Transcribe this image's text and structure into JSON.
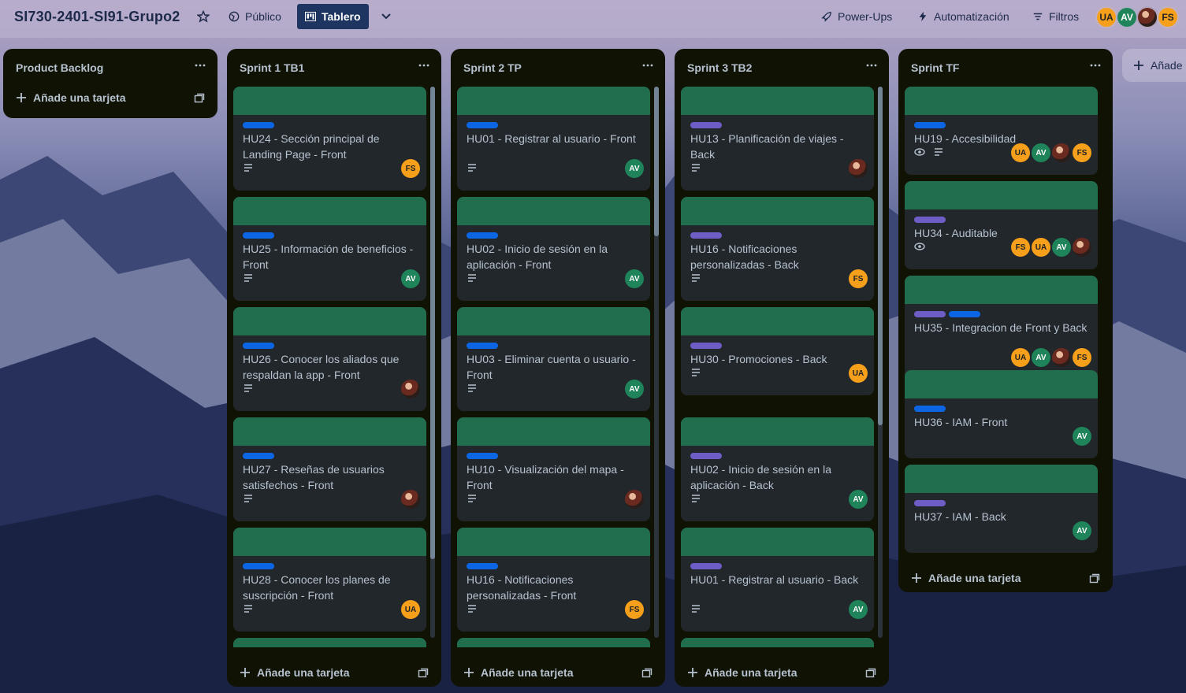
{
  "header": {
    "board_title": "SI730-2401-SI91-Grupo2",
    "visibility": "Público",
    "view": "Tablero",
    "powerups": "Power-Ups",
    "automation": "Automatización",
    "filters": "Filtros",
    "members": [
      {
        "initials": "UA",
        "color": "#f59f1b"
      },
      {
        "initials": "AV",
        "color": "#1f845a"
      },
      {
        "initials": "",
        "photo": true
      },
      {
        "initials": "FS",
        "color": "#f59f1b"
      }
    ]
  },
  "add_card_label": "Añade una tarjeta",
  "add_list_label": "Añade",
  "lists": [
    {
      "title": "Product Backlog",
      "cards": []
    },
    {
      "title": "Sprint 1 TB1",
      "cards": [
        {
          "labels": [
            "blue"
          ],
          "title": "HU24 - Sección principal de Landing Page - Front",
          "members": [
            "FS"
          ]
        },
        {
          "labels": [
            "blue"
          ],
          "title": "HU25 - Información de beneficios - Front",
          "members": [
            "AV"
          ]
        },
        {
          "labels": [
            "blue"
          ],
          "title": "HU26 - Conocer los aliados que respaldan la app - Front",
          "members": [
            "photo"
          ]
        },
        {
          "labels": [
            "blue"
          ],
          "title": "HU27 - Reseñas de usuarios satisfechos - Front",
          "members": [
            "photo"
          ]
        },
        {
          "labels": [
            "blue"
          ],
          "title": "HU28 - Conocer los planes de suscripción - Front",
          "members": [
            "UA"
          ]
        }
      ]
    },
    {
      "title": "Sprint 2 TP",
      "cards": [
        {
          "labels": [
            "blue"
          ],
          "title": "HU01 - Registrar al usuario - Front",
          "members": [
            "AV"
          ]
        },
        {
          "labels": [
            "blue"
          ],
          "title": "HU02 - Inicio de sesión en la aplicación - Front",
          "members": [
            "AV"
          ]
        },
        {
          "labels": [
            "blue"
          ],
          "title": "HU03 - Eliminar cuenta o usuario - Front",
          "members": [
            "AV"
          ]
        },
        {
          "labels": [
            "blue"
          ],
          "title": "HU10 - Visualización del mapa - Front",
          "members": [
            "photo"
          ]
        },
        {
          "labels": [
            "blue"
          ],
          "title": "HU16 - Notificaciones personalizadas - Front",
          "members": [
            "FS"
          ]
        }
      ]
    },
    {
      "title": "Sprint 3 TB2",
      "cards": [
        {
          "labels": [
            "purple"
          ],
          "title": "HU13 - Planificación de viajes - Back",
          "members": [
            "photo"
          ]
        },
        {
          "labels": [
            "purple"
          ],
          "title": "HU16 - Notificaciones personalizadas - Back",
          "members": [
            "FS"
          ]
        },
        {
          "labels": [
            "purple"
          ],
          "title": "HU30 - Promociones - Back",
          "members": [
            "UA"
          ]
        },
        {
          "labels": [
            "purple"
          ],
          "title": "HU02 - Inicio de sesión en la aplicación - Back",
          "members": [
            "AV"
          ]
        },
        {
          "labels": [
            "purple"
          ],
          "title": "HU01 - Registrar al usuario - Back",
          "members": [
            "AV"
          ]
        }
      ]
    },
    {
      "title": "Sprint TF",
      "cards": [
        {
          "labels": [
            "blue"
          ],
          "title": "HU19 - Accesibilidad",
          "members": [
            "UA",
            "AV",
            "photo",
            "FS"
          ]
        },
        {
          "labels": [
            "purple"
          ],
          "title": "HU34 - Auditable",
          "members": [
            "FS",
            "UA",
            "AV",
            "photo"
          ]
        },
        {
          "labels": [
            "purple",
            "blue"
          ],
          "title": "HU35 - Integracion de Front y Back",
          "members": [
            "UA",
            "AV",
            "photo",
            "FS"
          ]
        },
        {
          "labels": [
            "blue"
          ],
          "title": "HU36 - IAM - Front",
          "members": [
            "AV"
          ]
        },
        {
          "labels": [
            "purple"
          ],
          "title": "HU37 - IAM - Back",
          "members": [
            "AV"
          ]
        }
      ]
    }
  ]
}
